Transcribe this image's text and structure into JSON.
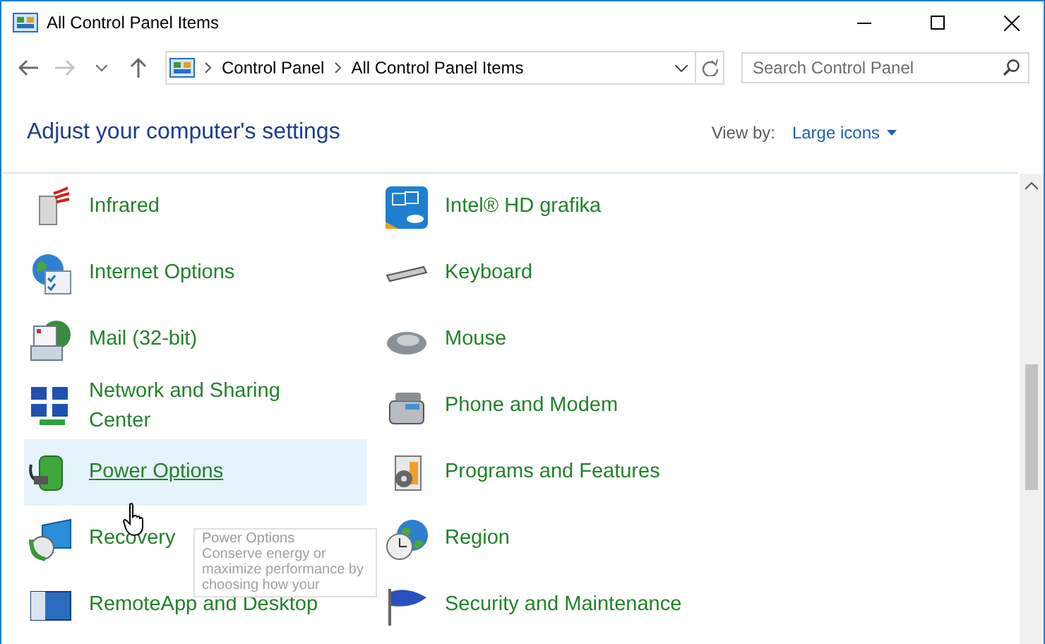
{
  "window": {
    "title": "All Control Panel Items"
  },
  "address_bar": {
    "breadcrumbs": [
      "Control Panel",
      "All Control Panel Items"
    ]
  },
  "search": {
    "placeholder": "Search Control Panel"
  },
  "header": {
    "title": "Adjust your computer's settings",
    "view_by_label": "View by:",
    "view_by_value": "Large icons"
  },
  "items": [
    {
      "label": "Infrared",
      "hovered": false
    },
    {
      "label": "Intel® HD grafika",
      "hovered": false
    },
    {
      "label": "Internet Options",
      "hovered": false
    },
    {
      "label": "Keyboard",
      "hovered": false
    },
    {
      "label": "Mail (32-bit)",
      "hovered": false
    },
    {
      "label": "Mouse",
      "hovered": false
    },
    {
      "label": "Network and Sharing Center",
      "hovered": false
    },
    {
      "label": "Phone and Modem",
      "hovered": false
    },
    {
      "label": "Power Options",
      "hovered": true
    },
    {
      "label": "Programs and Features",
      "hovered": false
    },
    {
      "label": "Recovery",
      "hovered": false
    },
    {
      "label": "Region",
      "hovered": false
    },
    {
      "label": "RemoteApp and Desktop",
      "hovered": false
    },
    {
      "label": "Security and Maintenance",
      "hovered": false
    }
  ],
  "tooltip": {
    "title": "Power Options",
    "description": "Conserve energy or maximize performance by choosing how your"
  }
}
